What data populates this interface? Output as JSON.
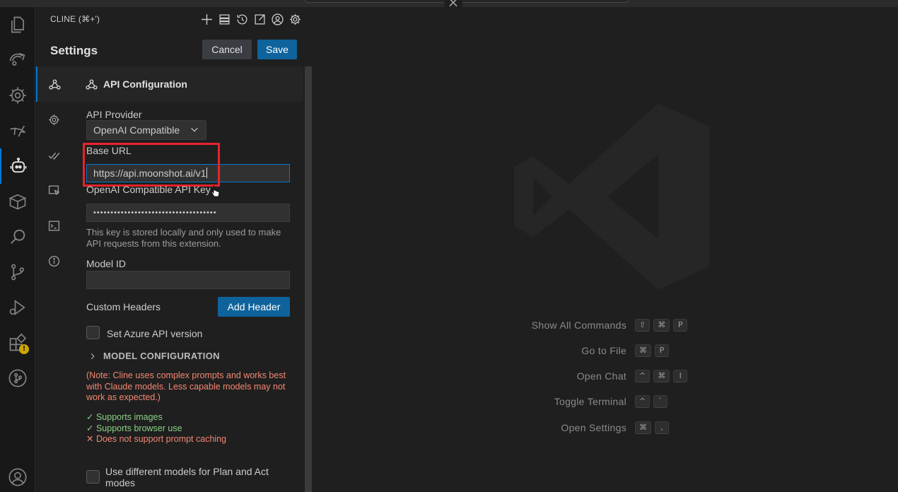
{
  "panel": {
    "title": "CLINE (⌘+')",
    "settings_title": "Settings",
    "cancel_label": "Cancel",
    "save_label": "Save",
    "header_icons": [
      "plus-icon",
      "server-icon",
      "history-icon",
      "popout-icon",
      "account-icon",
      "gear-icon"
    ]
  },
  "settings_tabs": [
    "api-configuration",
    "general",
    "features",
    "browser",
    "terminal",
    "about"
  ],
  "api": {
    "section_title": "API Configuration",
    "provider_label": "API Provider",
    "provider_value": "OpenAI Compatible",
    "base_url_label": "Base URL",
    "base_url_value": "https://api.moonshot.ai/v1",
    "api_key_label": "OpenAI Compatible API Key",
    "api_key_value": "••••••••••••••••••••••••••••••••••••",
    "api_key_note": "This key is stored locally and only used to make API requests from this extension.",
    "model_id_label": "Model ID",
    "model_id_value": "",
    "custom_headers_label": "Custom Headers",
    "add_header_label": "Add Header",
    "azure_label": "Set Azure API version",
    "model_config_label": "MODEL CONFIGURATION",
    "warning_note": "(Note: Cline uses complex prompts and works best with Claude models. Less capable models may not work as expected.)",
    "cap_images": "Supports images",
    "cap_browser": "Supports browser use",
    "cap_no_cache": "Does not support prompt caching",
    "plan_act_label": "Use different models for Plan and Act modes"
  },
  "editor": {
    "shortcuts": [
      {
        "label": "Show All Commands",
        "keys": [
          "⇧",
          "⌘",
          "P"
        ]
      },
      {
        "label": "Go to File",
        "keys": [
          "⌘",
          "P"
        ]
      },
      {
        "label": "Open Chat",
        "keys": [
          "^",
          "⌘",
          "I"
        ]
      },
      {
        "label": "Toggle Terminal",
        "keys": [
          "^",
          "`"
        ]
      },
      {
        "label": "Open Settings",
        "keys": [
          "⌘",
          ","
        ]
      }
    ]
  },
  "colors": {
    "accent": "#0e639c",
    "highlight_box": "#e8232b",
    "warning_text": "#f48771",
    "success_text": "#89d185"
  }
}
